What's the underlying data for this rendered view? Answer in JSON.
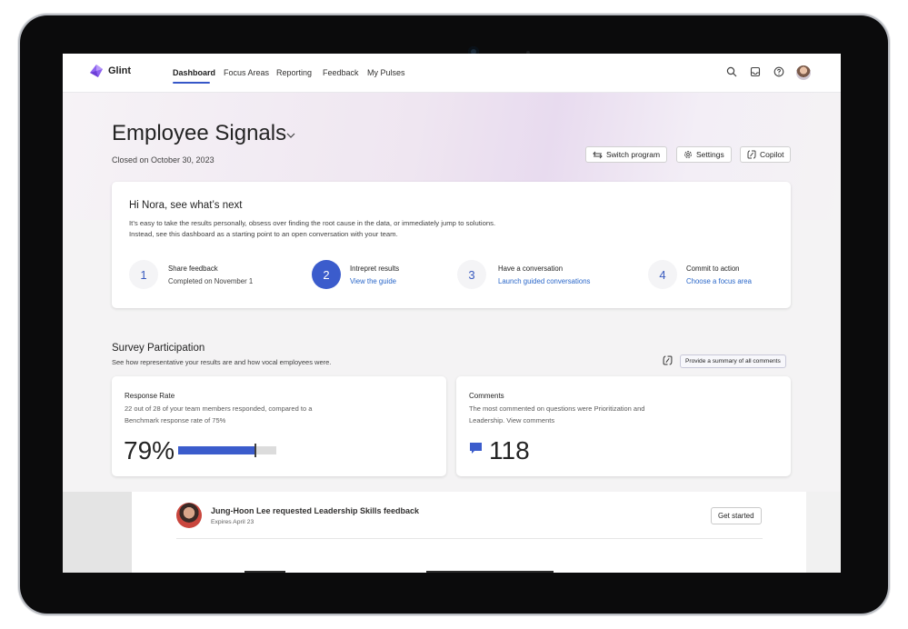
{
  "app": {
    "brand": "Glint"
  },
  "nav": {
    "tabs": [
      {
        "label": "Dashboard"
      },
      {
        "label": "Focus Areas"
      },
      {
        "label": "Reporting"
      },
      {
        "label": "Feedback"
      },
      {
        "label": "My Pulses"
      }
    ],
    "icons": [
      "search-icon",
      "inbox-icon",
      "help-icon",
      "user-avatar"
    ]
  },
  "header": {
    "title": "Employee Signals",
    "closed": "Closed on October 30, 2023",
    "buttons": {
      "switch_program": "Switch program",
      "settings": "Settings",
      "copilot": "Copilot"
    }
  },
  "welcome": {
    "greeting": "Hi Nora, see what’s next",
    "line1": "It’s easy to take the results personally, obsess over finding the root cause in the data, or immediately jump to solutions.",
    "line2": "Instead, see this dashboard as a starting point to an open conversation with your team.",
    "steps": [
      {
        "number": "1",
        "title": "Share feedback",
        "subtitle": "Completed on November 1"
      },
      {
        "number": "2",
        "title": "Intrepret results",
        "link": "View the guide",
        "active": true
      },
      {
        "number": "3",
        "title": "Have a conversation",
        "link": "Launch guided conversations"
      },
      {
        "number": "4",
        "title": "Commit to action",
        "link": "Choose a focus area"
      }
    ]
  },
  "participation": {
    "title": "Survey Participation",
    "subtitle": "See how representative your results are and how vocal employees were.",
    "summary_button": "Provide a summary of all comments",
    "response": {
      "title": "Response Rate",
      "line1": "22 out of 28 of your team members responded, compared to a",
      "line2": "Benchmark response rate of 75%",
      "value": "79%",
      "fill_fraction": 0.79,
      "benchmark_fraction": 0.75
    },
    "comments": {
      "title": "Comments",
      "line1": "The most commented on questions were Prioritization and",
      "line2": "Leadership. View comments",
      "value": "118"
    }
  },
  "request": {
    "title": "Jung-Hoon Lee requested Leadership Skills feedback",
    "expires": "Expires April 23",
    "button": "Get started"
  },
  "colors": {
    "accent": "#3b5ccc",
    "link": "#2a67c9",
    "brand": "#8a5cf6"
  }
}
